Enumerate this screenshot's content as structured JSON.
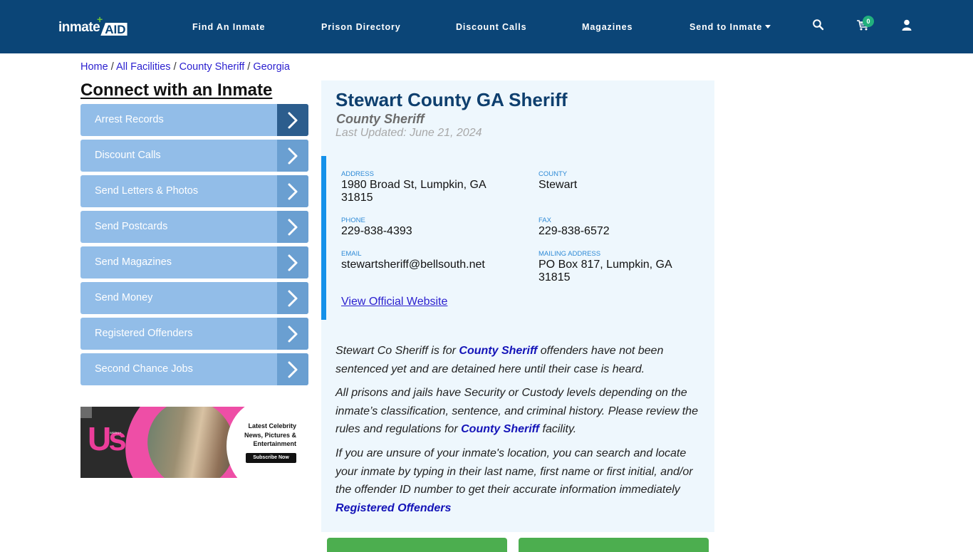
{
  "header": {
    "logo": {
      "word": "inmate",
      "accent": "AID",
      "plus": "+"
    },
    "nav": [
      {
        "label": "Find An Inmate"
      },
      {
        "label": "Prison Directory"
      },
      {
        "label": "Discount Calls"
      },
      {
        "label": "Magazines"
      },
      {
        "label": "Send to Inmate",
        "has_dropdown": true
      }
    ],
    "icons": {
      "search": "search-icon",
      "cart": "cart-icon",
      "user": "user-icon"
    },
    "cart_count": "0",
    "colors": {
      "background": "#0b4577",
      "badge": "#22b07d"
    }
  },
  "breadcrumb": [
    {
      "label": "Home"
    },
    {
      "label": "All Facilities"
    },
    {
      "label": "County Sheriff"
    },
    {
      "label": "Georgia"
    }
  ],
  "breadcrumb_separator": "/",
  "sidebar": {
    "title": "Connect with an Inmate",
    "items": [
      {
        "label": "Arrest Records",
        "active": true
      },
      {
        "label": "Discount Calls"
      },
      {
        "label": "Send Letters & Photos"
      },
      {
        "label": "Send Postcards"
      },
      {
        "label": "Send Magazines"
      },
      {
        "label": "Send Money"
      },
      {
        "label": "Registered Offenders"
      },
      {
        "label": "Second Chance Jobs"
      }
    ],
    "ad": {
      "brand": "Us",
      "brand_small": "WEEKLY",
      "tagline": "Latest Celebrity News, Pictures & Entertainment",
      "button": "Subscribe Now"
    }
  },
  "facility": {
    "name": "Stewart County GA Sheriff",
    "type": "County Sheriff",
    "last_updated": "Last Updated: June 21, 2024",
    "fields": {
      "address": {
        "label": "ADDRESS",
        "value": "1980 Broad St, Lumpkin, GA 31815"
      },
      "county": {
        "label": "COUNTY",
        "value": "Stewart"
      },
      "phone": {
        "label": "PHONE",
        "value": "229-838-4393"
      },
      "fax": {
        "label": "FAX",
        "value": "229-838-6572"
      },
      "email": {
        "label": "EMAIL",
        "value": "stewartsheriff@bellsouth.net"
      },
      "mailing": {
        "label": "MAILING ADDRESS",
        "value": "PO Box 817, Lumpkin, GA 31815"
      }
    },
    "official_link": "View Official Website"
  },
  "description": {
    "p1": {
      "pre": "Stewart Co Sheriff is for ",
      "bold": "County Sheriff",
      "post": " offenders have not been sentenced yet and are detained here until their case is heard."
    },
    "p2": {
      "pre": "All prisons and jails have Security or Custody levels depending on the inmate’s classification, sentence, and criminal history. Please review the rules and regulations for ",
      "bold": "County Sheriff",
      "post": " facility."
    },
    "p3": {
      "text": "If you are unsure of your inmate's location, you can search and locate your inmate by typing in their last name, first name or first initial, and/or the offender ID number to get their accurate information immediately",
      "link": "Registered Offenders"
    }
  }
}
